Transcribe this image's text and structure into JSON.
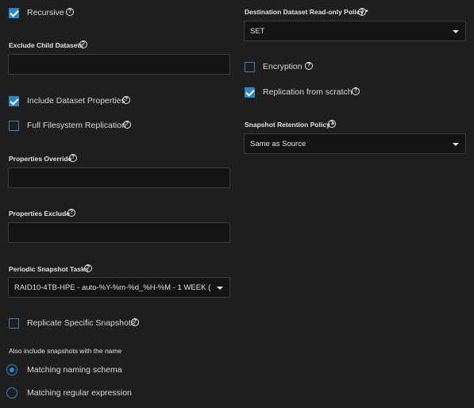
{
  "left": {
    "recursive": {
      "label": "Recursive",
      "checked": true
    },
    "exclude_child_datasets": {
      "label": "Exclude Child Datasets",
      "value": ""
    },
    "include_dataset_properties": {
      "label": "Include Dataset Properties",
      "checked": true
    },
    "full_filesystem_replication": {
      "label": "Full Filesystem Replication",
      "checked": false
    },
    "properties_override": {
      "label": "Properties Override",
      "value": ""
    },
    "properties_exclude": {
      "label": "Properties Exclude",
      "value": ""
    },
    "periodic_snapshot_tasks": {
      "label": "Periodic Snapshot Tasks",
      "value": "RAID10-4TB-HPE - auto-%Y-%m-%d_%H-%M - 1 WEEK (S) ..."
    },
    "replicate_specific_snapshots": {
      "label": "Replicate Specific Snapshots",
      "checked": false
    },
    "also_include_label": "Also include snapshots with the name",
    "naming_options": [
      {
        "label": "Matching naming schema",
        "selected": true
      },
      {
        "label": "Matching regular expression",
        "selected": false
      }
    ]
  },
  "right": {
    "destination_readonly_policy": {
      "label": "Destination Dataset Read-only Policy",
      "required_mark": "*",
      "value": "SET"
    },
    "encryption": {
      "label": "Encryption",
      "checked": false
    },
    "replication_from_scratch": {
      "label": "Replication from scratch",
      "checked": true
    },
    "snapshot_retention_policy": {
      "label": "Snapshot Retention Policy",
      "required_mark": "*",
      "value": "Same as Source"
    }
  },
  "icons": {
    "help": "?"
  },
  "colors": {
    "background": "#1e1e1e",
    "accent": "#2f86c4",
    "input_bg": "#141414"
  }
}
